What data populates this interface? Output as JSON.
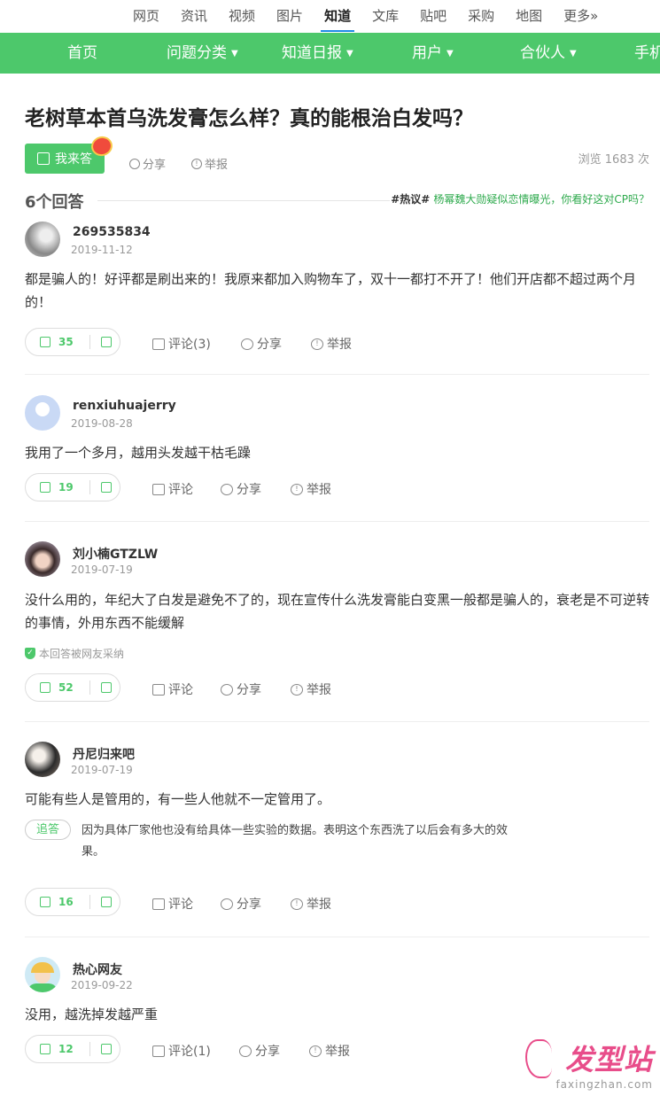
{
  "topnav": [
    "网页",
    "资讯",
    "视频",
    "图片",
    "知道",
    "文库",
    "贴吧",
    "采购",
    "地图",
    "更多»"
  ],
  "greenbar": [
    {
      "label": "首页",
      "chev": false
    },
    {
      "label": "问题分类",
      "chev": true
    },
    {
      "label": "知道日报",
      "chev": true
    },
    {
      "label": "用户",
      "chev": true
    },
    {
      "label": "合伙人",
      "chev": true
    },
    {
      "label": "手机",
      "chev": false
    }
  ],
  "question": {
    "title": "老树草本首乌洗发膏怎么样？真的能根治白发吗？",
    "answer_btn": "我来答",
    "share": "分享",
    "report": "举报",
    "views": "浏览 1683 次"
  },
  "answers_count": "6个回答",
  "hot": {
    "tag": "#热议#",
    "text": "杨幂魏大勋疑似恋情曝光，你看好这对CP吗？"
  },
  "answers": [
    {
      "user": "269535834",
      "date": "2019-11-12",
      "content": "都是骗人的！好评都是刷出来的！我原来都加入购物车了，双十一都打不开了！他们开店都不超过两个月的！",
      "likes": "35",
      "comment": "评论(3)",
      "share": "分享",
      "report": "举报"
    },
    {
      "user": "renxiuhuajerry",
      "date": "2019-08-28",
      "content": "我用了一个多月，越用头发越干枯毛躁",
      "likes": "19",
      "comment": "评论",
      "share": "分享",
      "report": "举报"
    },
    {
      "user": "刘小楠GTZLW",
      "date": "2019-07-19",
      "content": "没什么用的，年纪大了白发是避免不了的，现在宣传什么洗发膏能白变黑一般都是骗人的，衰老是不可逆转的事情，外用东西不能缓解",
      "adopted": "本回答被网友采纳",
      "likes": "52",
      "comment": "评论",
      "share": "分享",
      "report": "举报"
    },
    {
      "user": "丹尼归来吧",
      "date": "2019-07-19",
      "content": "可能有些人是管用的，有一些人他就不一定管用了。",
      "follow_tag": "追答",
      "follow_text": "因为具体厂家他也没有给具体一些实验的数据。表明这个东西洗了以后会有多大的效果。",
      "likes": "16",
      "comment": "评论",
      "share": "分享",
      "report": "举报"
    },
    {
      "user": "热心网友",
      "date": "2019-09-22",
      "content": "没用，越洗掉发越严重",
      "likes": "12",
      "comment": "评论(1)",
      "share": "分享",
      "report": "举报"
    }
  ],
  "watermark": {
    "logo": "发型站",
    "url": "faxingzhan.com"
  },
  "colors": {
    "brand_green": "#4dc86b",
    "nav_active": "#1e8be6"
  }
}
